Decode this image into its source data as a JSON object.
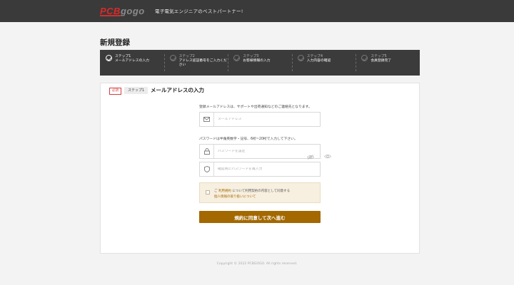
{
  "header": {
    "logo_part1": "PCB",
    "logo_part2": "gogo",
    "tagline": "電子電気エンジニアのベストパートナー!"
  },
  "page_title": "新規登録",
  "steps": [
    {
      "num": "ステップ1",
      "name": "メールアドレスの入力",
      "state": "done"
    },
    {
      "num": "ステップ2",
      "name": "アドレス認証番号をご入力ください",
      "state": "todo"
    },
    {
      "num": "ステップ3",
      "name": "お客様情報の入力",
      "state": "todo"
    },
    {
      "num": "ステップ4",
      "name": "入力内容の確認",
      "state": "todo"
    },
    {
      "num": "ステップ5",
      "name": "会員登録完了",
      "state": "todo"
    }
  ],
  "card": {
    "required_badge": "必須",
    "step_badge": "ステップ1",
    "title": "メールアドレスの入力",
    "email_label": "登録メールアドレスは、サポートや出荷通知などのご連絡先となります。",
    "email_placeholder": "メールアドレス",
    "password_label": "パスワードは半角英数字・記号、6桁~20桁で入力して下さい。",
    "password_placeholder": "パスワードを設定",
    "confirm_placeholder": "確認用にパスワードを再入力",
    "agree_prefix": "ご",
    "agree_link": "利用規約",
    "agree_suffix": "について利用契約の内容として同意する",
    "privacy_link": "個人情報の取り扱いについて",
    "submit_label": "規約に同意して次へ進む"
  },
  "footer": "Copyright © 2022 PCBGOGO. All rights reserved.",
  "colors": {
    "accent": "#a36800",
    "header_bg": "#3a3a3a",
    "logo_red": "#d62b2b"
  }
}
